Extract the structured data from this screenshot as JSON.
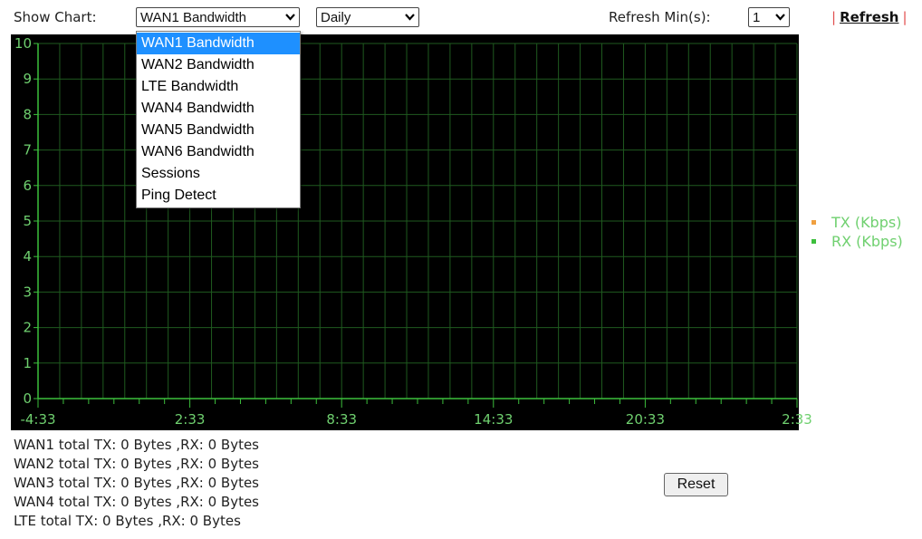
{
  "toolbar": {
    "show_chart_label": "Show Chart:",
    "chart_select_value": "WAN1 Bandwidth",
    "period_select_value": "Daily",
    "refresh_min_label": "Refresh Min(s):",
    "refresh_min_value": "1",
    "pipe": "|",
    "refresh_link": "Refresh"
  },
  "dropdown": {
    "options": [
      "WAN1 Bandwidth",
      "WAN2 Bandwidth",
      "LTE Bandwidth",
      "WAN4 Bandwidth",
      "WAN5 Bandwidth",
      "WAN6 Bandwidth",
      "Sessions",
      "Ping Detect"
    ],
    "selected_index": 0
  },
  "chart_data": {
    "type": "line",
    "x_tick_labels": [
      "-4:33",
      "2:33",
      "8:33",
      "14:33",
      "20:33",
      "2:33"
    ],
    "y_tick_labels": [
      "0",
      "1",
      "2",
      "3",
      "4",
      "5",
      "6",
      "7",
      "8",
      "9",
      "10"
    ],
    "ylim": [
      0,
      10
    ],
    "grid": true,
    "legend_position": "right",
    "series": [
      {
        "name": "TX (Kbps)",
        "color": "#f0a040",
        "values": []
      },
      {
        "name": "RX (Kbps)",
        "color": "#3cbf3c",
        "values": []
      }
    ],
    "background_color": "#000000",
    "grid_color": "#1f5a1f",
    "axis_color": "#3cbf3c",
    "label_color": "#6fd06f"
  },
  "totals": [
    "WAN1 total TX: 0 Bytes ,RX: 0 Bytes",
    "WAN2 total TX: 0 Bytes ,RX: 0 Bytes",
    "WAN3 total TX: 0 Bytes ,RX: 0 Bytes",
    "WAN4 total TX: 0 Bytes ,RX: 0 Bytes",
    "LTE total TX: 0 Bytes ,RX: 0 Bytes"
  ],
  "reset_label": "Reset"
}
